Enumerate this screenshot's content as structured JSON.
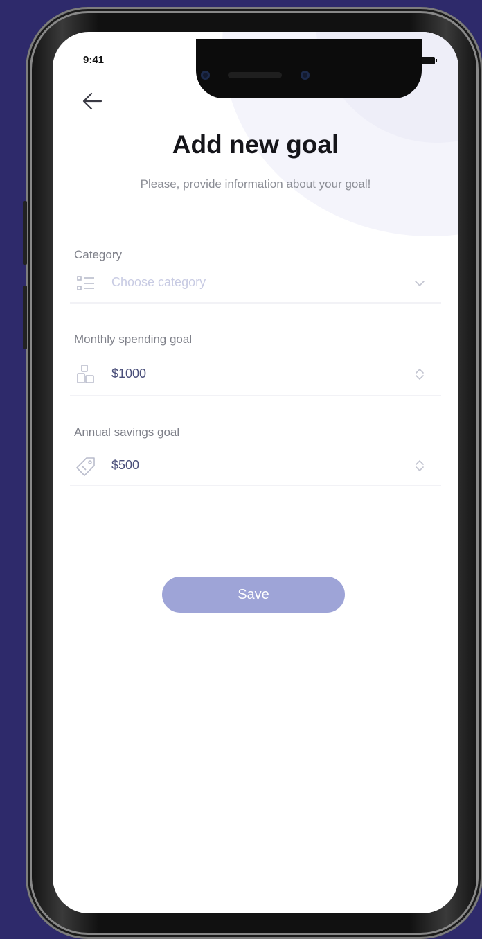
{
  "status_bar": {
    "time": "9:41"
  },
  "header": {
    "title": "Add new goal",
    "subtitle": "Please, provide information about your goal!"
  },
  "form": {
    "category": {
      "label": "Category",
      "placeholder": "Choose category",
      "icon": "list-icon"
    },
    "monthly_spending": {
      "label": "Monthly spending goal",
      "value": "$1000",
      "icon": "coins-icon"
    },
    "annual_savings": {
      "label": "Annual savings goal",
      "value": "$500",
      "icon": "tag-icon"
    }
  },
  "actions": {
    "save_label": "Save"
  },
  "colors": {
    "background": "#2e2a6b",
    "accent": "#9ea4d7",
    "value_text": "#4a4f7a",
    "placeholder_text": "#c8cbe3"
  }
}
